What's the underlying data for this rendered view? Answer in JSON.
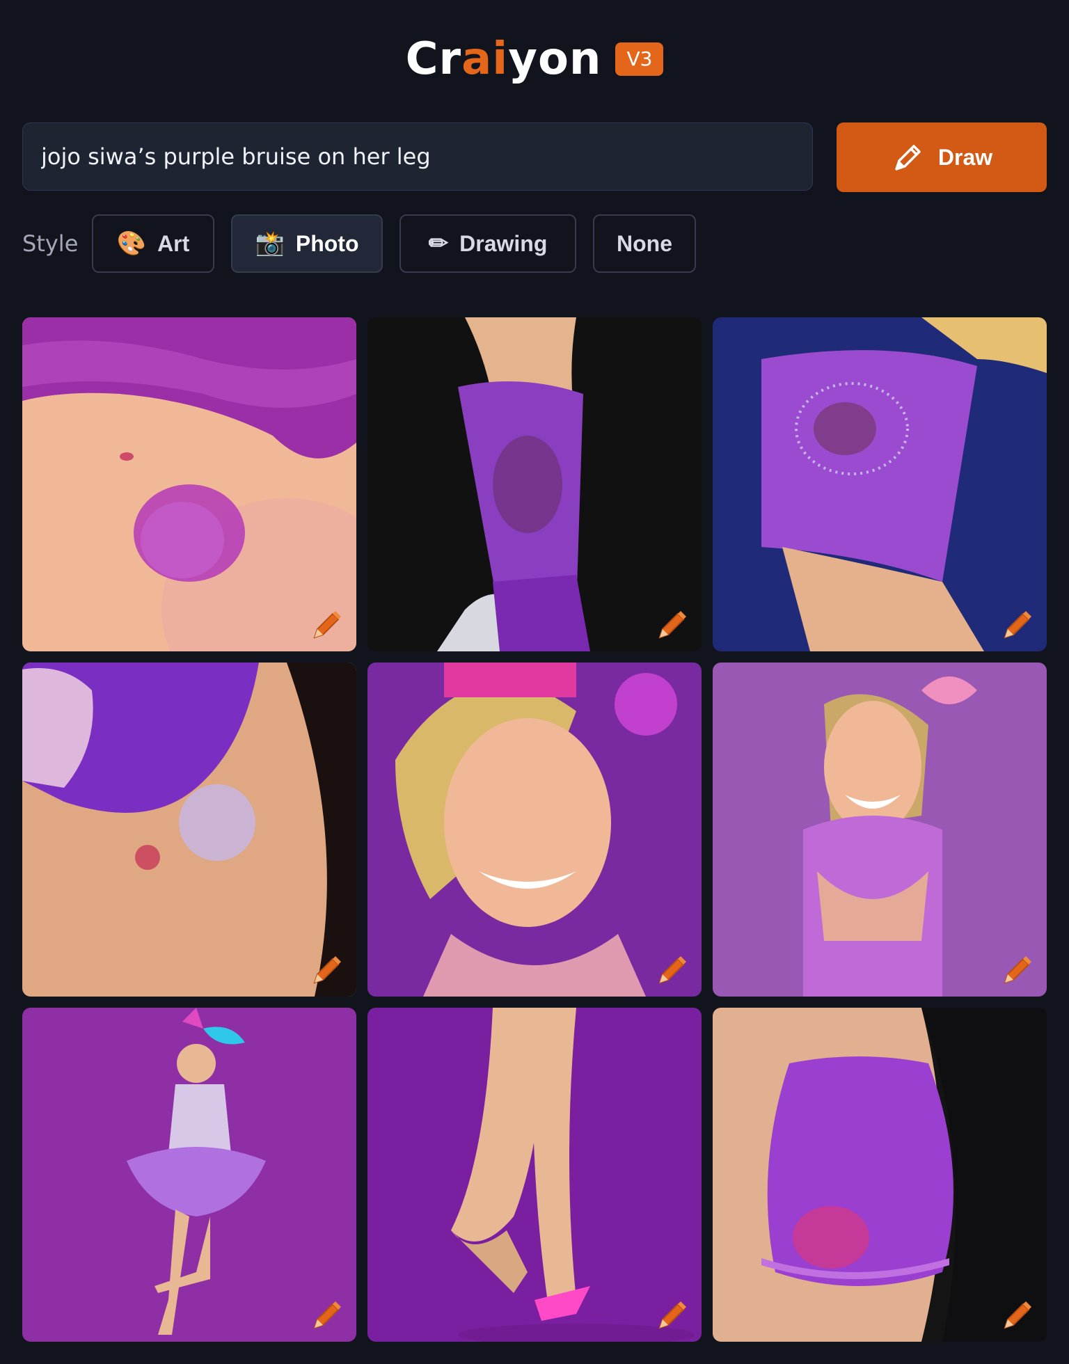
{
  "app": {
    "logo_parts": [
      "Cr",
      "ai",
      "yon"
    ],
    "version": "V3",
    "accent_color": "#e4661b",
    "background_color": "#11141d"
  },
  "prompt": {
    "value": "jojo siwa’s purple bruise on her leg",
    "draw_label": "Draw",
    "draw_icon": "pencil-icon"
  },
  "style": {
    "label": "Style",
    "options": [
      {
        "label": "Art",
        "icon": "palette-icon",
        "glyph": "🎨",
        "selected": false
      },
      {
        "label": "Photo",
        "icon": "camera-flash-icon",
        "glyph": "📸",
        "selected": true
      },
      {
        "label": "Drawing",
        "icon": "pencil-icon",
        "glyph": "✏",
        "selected": false
      },
      {
        "label": "None",
        "icon": "",
        "glyph": "",
        "selected": false
      }
    ]
  },
  "results": {
    "images": [
      {
        "subject": "skin-with-bruise",
        "bg": "#f0b896",
        "accent": "#b43ab8"
      },
      {
        "subject": "leg-purple-sock",
        "bg": "#111111",
        "accent": "#8a3fc0"
      },
      {
        "subject": "hip-purple-shorts",
        "bg": "#1f2a78",
        "accent": "#9b4bd0"
      },
      {
        "subject": "thigh-glitter-bruise",
        "bg": "#2a1a1a",
        "accent": "#7a2fc2"
      },
      {
        "subject": "smiling-girl-portrait",
        "bg": "#7a2aa0",
        "accent": "#f0b896"
      },
      {
        "subject": "laughing-girl-bow",
        "bg": "#9a58b5",
        "accent": "#f0b896"
      },
      {
        "subject": "dancer-tutu",
        "bg": "#8e2fa6",
        "accent": "#b070e0"
      },
      {
        "subject": "legs-heels",
        "bg": "#7a1fa0",
        "accent": "#e8b894"
      },
      {
        "subject": "thigh-purple-band",
        "bg": "#141414",
        "accent": "#9a3fd0"
      }
    ],
    "edit_icon": "pencil-icon"
  }
}
